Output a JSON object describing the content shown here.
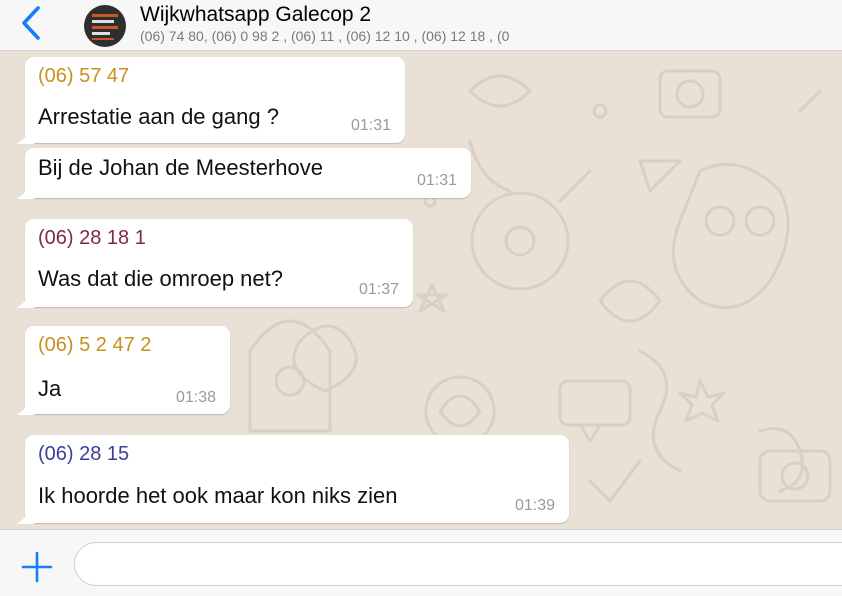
{
  "header": {
    "title": "Wijkwhatsapp Galecop 2",
    "participants": "(06)           74 80, (06)  0 98   2     , (06) 11               , (06) 12 10           , (06) 12 18         , (0",
    "back_icon": "chevron-left-icon",
    "accent_color": "#157efb"
  },
  "messages": [
    {
      "sender": "(06) 57        47",
      "sender_color": "#c8901e",
      "text": "Arrestatie aan de gang ?",
      "time": "01:31"
    },
    {
      "sender": "",
      "sender_color": "",
      "text": "Bij de Johan de Meesterhove",
      "time": "01:31"
    },
    {
      "sender": "(06) 28        18    1",
      "sender_color": "#7b2a4e",
      "text": "Was dat die omroep net?",
      "time": "01:37"
    },
    {
      "sender": "(06) 5    2    47    2",
      "sender_color": "#c8901e",
      "text": "Ja",
      "time": "01:38"
    },
    {
      "sender": "(06) 28          15",
      "sender_color": "#3b3f99",
      "text": "Ik hoorde het ook maar kon niks zien",
      "time": "01:39"
    }
  ],
  "composer": {
    "placeholder": "",
    "value": "",
    "plus_icon": "plus-icon"
  }
}
